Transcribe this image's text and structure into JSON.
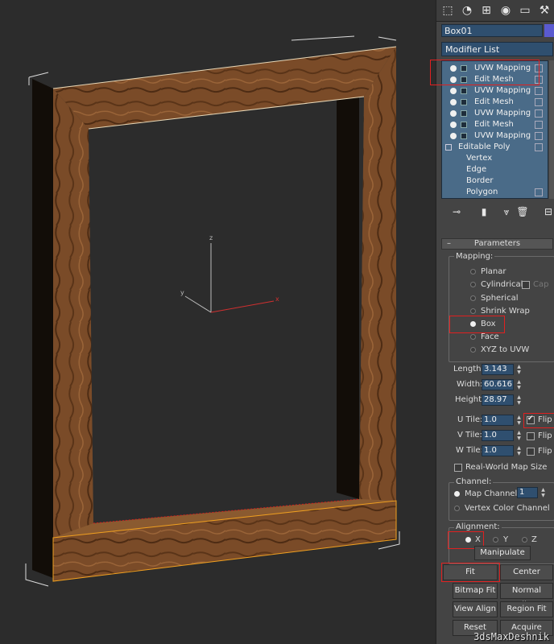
{
  "viewport": {
    "axis_z": "z",
    "axis_y": "y",
    "axis_x": "x",
    "wood_color": "#7a4b28",
    "select_color": "#f0a020"
  },
  "tabs": {
    "icons": [
      "create-icon",
      "modify-icon",
      "hierarchy-icon",
      "motion-icon",
      "display-icon",
      "utilities-icon"
    ]
  },
  "object_name": "Box01",
  "modifier_list_label": "Modifier List",
  "stack": {
    "modifiers": [
      {
        "label": "UVW Mapping"
      },
      {
        "label": "Edit Mesh"
      },
      {
        "label": "UVW Mapping"
      },
      {
        "label": "Edit Mesh"
      },
      {
        "label": "UVW Mapping"
      },
      {
        "label": "Edit Mesh"
      },
      {
        "label": "UVW Mapping"
      }
    ],
    "base": "Editable Poly",
    "sub": [
      "Vertex",
      "Edge",
      "Border",
      "Polygon"
    ]
  },
  "parameters": {
    "rollout_title": "Parameters",
    "mapping_label": "Mapping:",
    "mapping_options": [
      "Planar",
      "Cylindrical",
      "Spherical",
      "Shrink Wrap",
      "Box",
      "Face",
      "XYZ to UVW"
    ],
    "mapping_selected": "Box",
    "cap_label": "Cap",
    "length_label": "Length:",
    "length_value": "3.143",
    "width_label": "Width:",
    "width_value": "60.616",
    "height_label": "Height:",
    "height_value": "28.97",
    "utile_label": "U Tile:",
    "utile_value": "1.0",
    "vtile_label": "V Tile:",
    "vtile_value": "1.0",
    "wtile_label": "W Tile:",
    "wtile_value": "1.0",
    "flip_label": "Flip",
    "uflip_checked": true,
    "realworld_label": "Real-World Map Size",
    "channel_label": "Channel:",
    "map_channel_label": "Map Channel:",
    "map_channel_value": "1",
    "vertex_color_label": "Vertex Color Channel",
    "alignment_label": "Alignment:",
    "align_x": "X",
    "align_y": "Y",
    "align_z": "Z",
    "align_selected": "X",
    "buttons": {
      "manipulate": "Manipulate",
      "fit": "Fit",
      "center": "Center",
      "bitmap_fit": "Bitmap Fit",
      "normal_align": "Normal Align",
      "view_align": "View Align",
      "region_fit": "Region Fit",
      "reset": "Reset",
      "acquire": "Acquire"
    }
  },
  "watermark": "3dsMaxDeshnik",
  "highlight_color": "#e02020"
}
